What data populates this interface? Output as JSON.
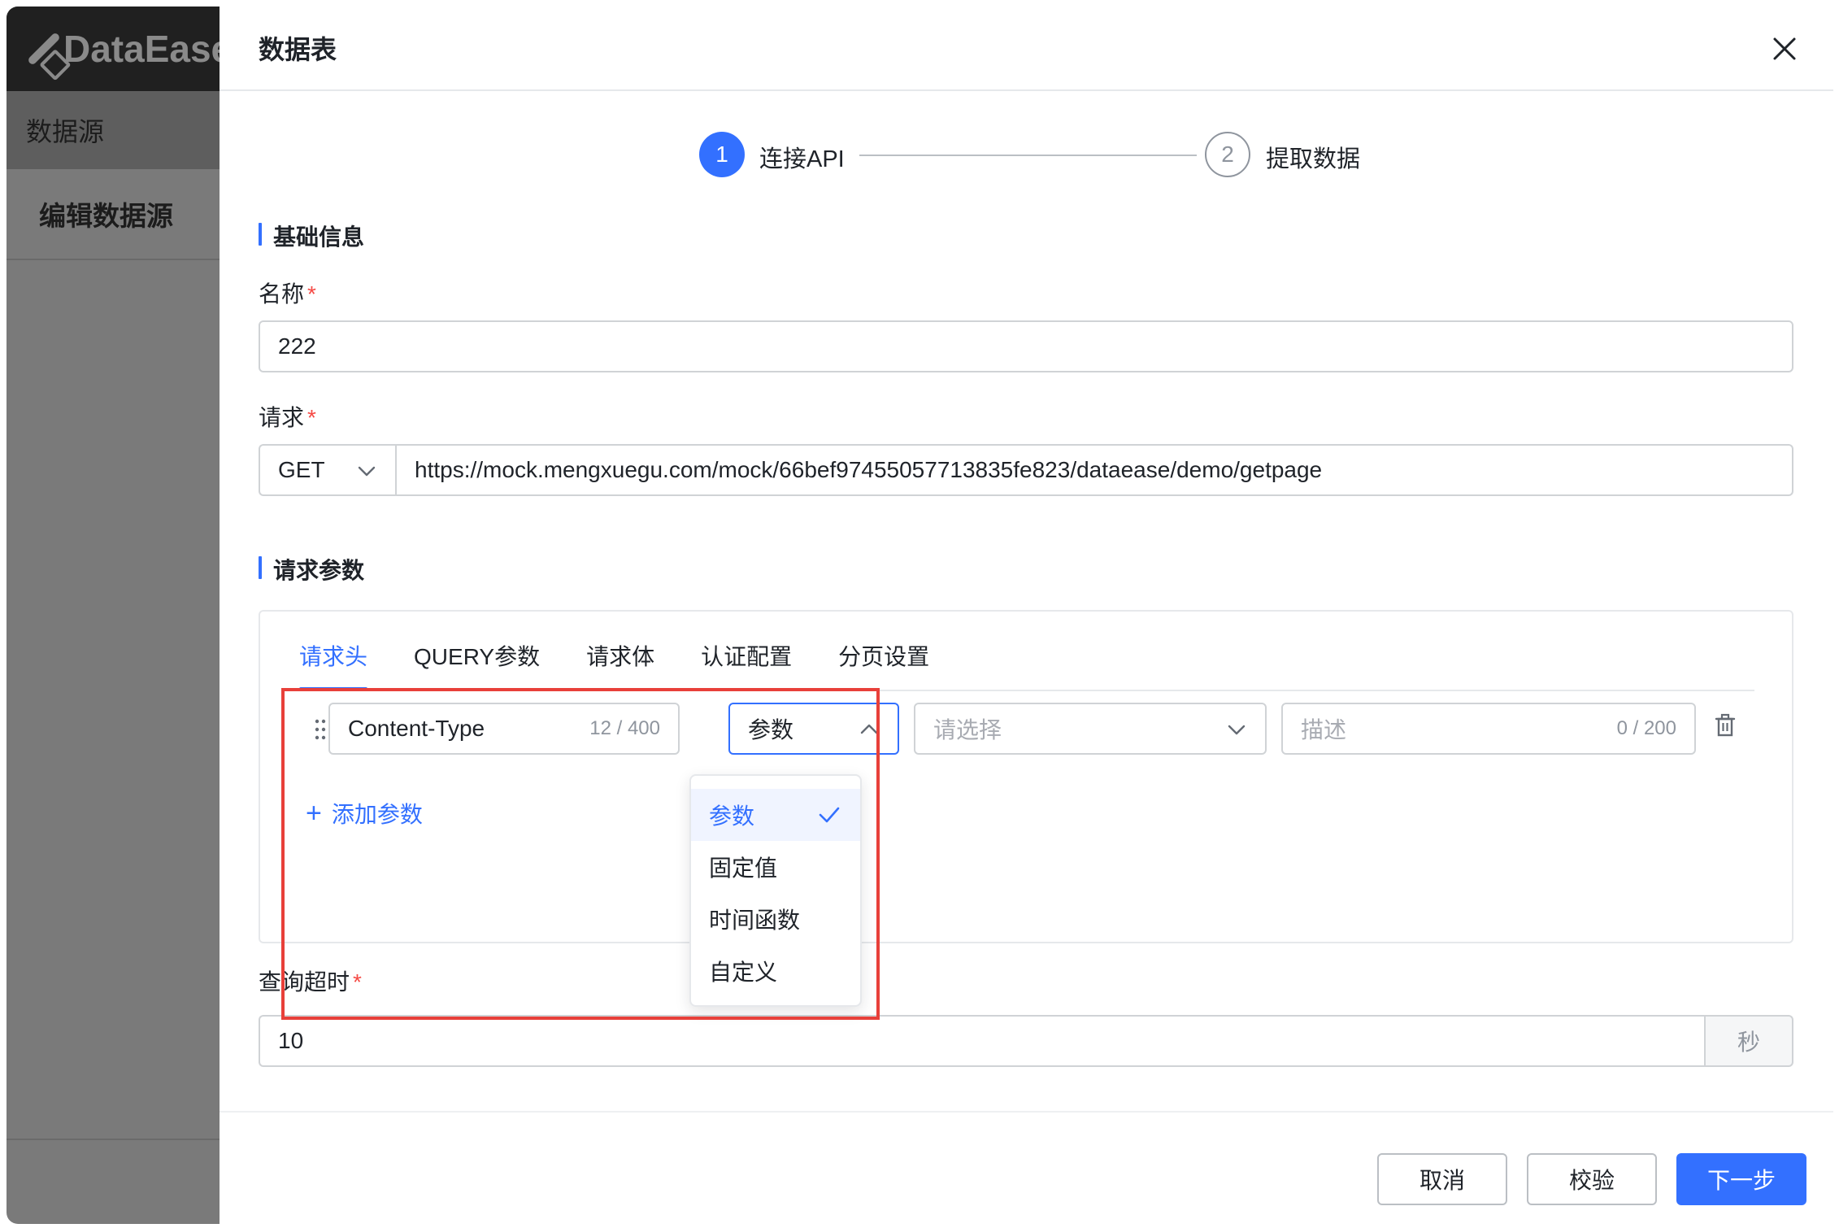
{
  "app": {
    "logo_text": "DataEase",
    "breadcrumb": "数据源",
    "nav_item": "编辑数据源"
  },
  "drawer": {
    "title": "数据表"
  },
  "steps": [
    {
      "number": "1",
      "label": "连接API",
      "state": "active"
    },
    {
      "number": "2",
      "label": "提取数据",
      "state": "todo"
    }
  ],
  "basic": {
    "section_title": "基础信息",
    "name_label": "名称",
    "name_value": "222",
    "request_label": "请求",
    "method": "GET",
    "url": "https://mock.mengxuegu.com/mock/66bef97455057713835fe823/dataease/demo/getpage",
    "required_mark": "*"
  },
  "params": {
    "section_title": "请求参数",
    "tabs": [
      "请求头",
      "QUERY参数",
      "请求体",
      "认证配置",
      "分页设置"
    ],
    "active_tab": "请求头",
    "row": {
      "key": "Content-Type",
      "key_counter": "12 / 400",
      "type": "参数",
      "value_placeholder": "请选择",
      "desc_placeholder": "描述",
      "desc_counter": "0 / 200"
    },
    "add_label": "添加参数",
    "dropdown_options": [
      {
        "label": "参数",
        "selected": true
      },
      {
        "label": "固定值",
        "selected": false
      },
      {
        "label": "时间函数",
        "selected": false
      },
      {
        "label": "自定义",
        "selected": false
      }
    ]
  },
  "timeout": {
    "label": "查询超时",
    "value": "10",
    "unit": "秒"
  },
  "footer": {
    "cancel": "取消",
    "validate": "校验",
    "next": "下一步"
  },
  "colors": {
    "primary": "#3370ff",
    "required": "#f54a45",
    "highlight": "#e8403a"
  }
}
